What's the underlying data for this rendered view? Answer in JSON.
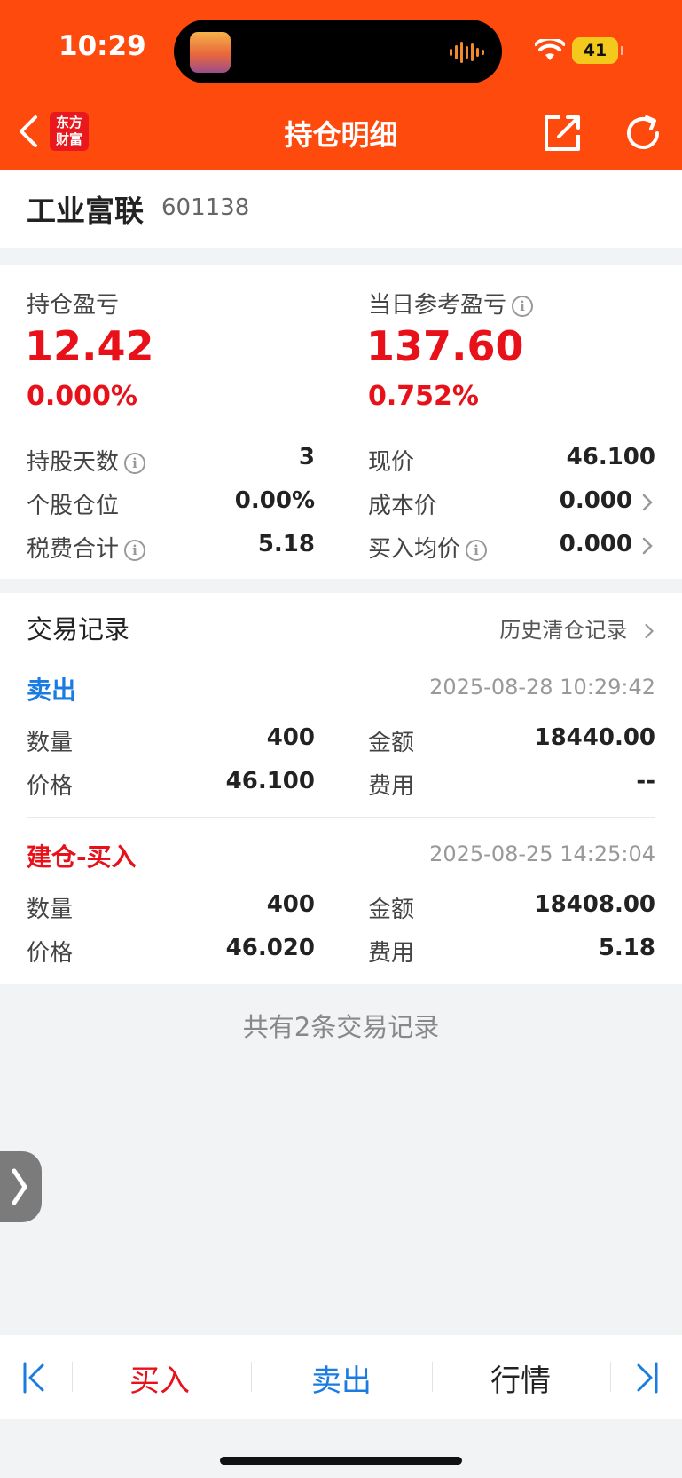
{
  "status_bar": {
    "time": "10:29",
    "battery": "41"
  },
  "nav": {
    "logo_text_line1": "东方",
    "logo_text_line2": "财富",
    "title": "持仓明细"
  },
  "stock": {
    "name": "工业富联",
    "code": "601138"
  },
  "summary": {
    "position_pl_label": "持仓盈亏",
    "position_pl_value": "12.42",
    "position_pl_pct": "0.000%",
    "daily_pl_label": "当日参考盈亏",
    "daily_pl_value": "137.60",
    "daily_pl_pct": "0.752%",
    "hold_days_label": "持股天数",
    "hold_days_value": "3",
    "price_label": "现价",
    "price_value": "46.100",
    "weight_label": "个股仓位",
    "weight_value": "0.00%",
    "cost_label": "成本价",
    "cost_value": "0.000",
    "fee_total_label": "税费合计",
    "fee_total_value": "5.18",
    "avg_buy_label": "买入均价",
    "avg_buy_value": "0.000"
  },
  "records": {
    "title": "交易记录",
    "history_link": "历史清仓记录",
    "items": [
      {
        "type": "卖出",
        "time": "2025-08-28 10:29:42",
        "qty_label": "数量",
        "qty": "400",
        "amount_label": "金额",
        "amount": "18440.00",
        "price_label": "价格",
        "price": "46.100",
        "fee_label": "费用",
        "fee": "--"
      },
      {
        "type": "建仓-买入",
        "time": "2025-08-25 14:25:04",
        "qty_label": "数量",
        "qty": "400",
        "amount_label": "金额",
        "amount": "18408.00",
        "price_label": "价格",
        "price": "46.020",
        "fee_label": "费用",
        "fee": "5.18"
      }
    ],
    "total_note": "共有2条交易记录"
  },
  "tabbar": {
    "buy": "买入",
    "sell": "卖出",
    "quote": "行情"
  },
  "colors": {
    "header": "#ff4a0d",
    "profit_red": "#e8111a",
    "sell_blue": "#1a7be0",
    "buy_red": "#e8111a"
  }
}
